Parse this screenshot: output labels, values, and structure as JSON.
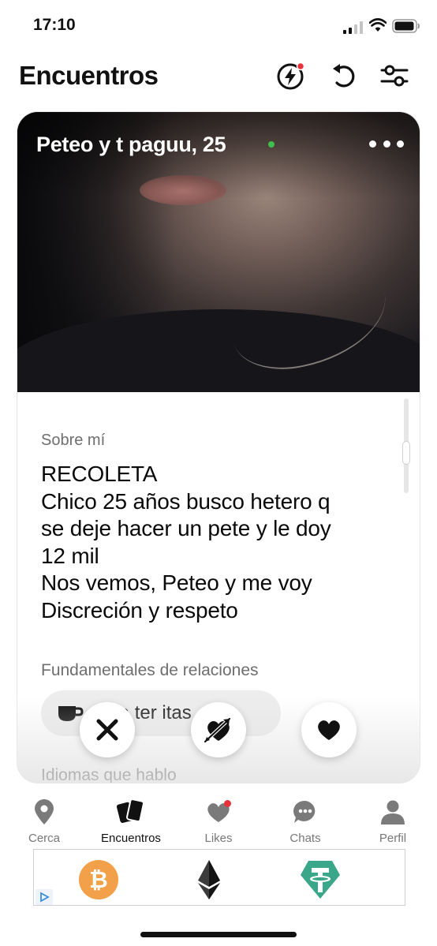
{
  "status_bar": {
    "time": "17:10"
  },
  "header": {
    "title": "Encuentros",
    "icons": [
      "boost-icon",
      "undo-icon",
      "filters-icon"
    ]
  },
  "profile": {
    "name_age": "Peteo y t paguu, 25",
    "online": true,
    "about_label": "Sobre mí",
    "bio_lines": [
      "RECOLETA",
      "Chico 25 años busco hetero q",
      "se deje hacer un pete y le doy",
      "12 mil",
      "Nos vemos, Peteo y me voy",
      "Discreción y respeto"
    ],
    "fundamentals_label": "Fundamentales de relaciones",
    "chip_visible_text": "para ter       itas",
    "languages_label": "Idiomas que hablo"
  },
  "actions": [
    "nope-x-icon",
    "super-like-heart-arrow-icon",
    "like-heart-icon"
  ],
  "bottom_nav": {
    "items": [
      {
        "label": "Cerca",
        "icon": "location-pin-icon",
        "active": false
      },
      {
        "label": "Encuentros",
        "icon": "cards-icon",
        "active": true
      },
      {
        "label": "Likes",
        "icon": "likes-icon",
        "active": false
      },
      {
        "label": "Chats",
        "icon": "chat-bubble-icon",
        "active": false
      },
      {
        "label": "Perfil",
        "icon": "profile-person-icon",
        "active": false
      }
    ]
  },
  "ad": {
    "coins": [
      "bitcoin-icon",
      "ethereum-icon",
      "tether-icon"
    ],
    "colors": {
      "bitcoin": "#f2a04a",
      "ethereum": "#3c3c3d",
      "tether": "#3aa68a"
    }
  },
  "colors": {
    "badge": "#e8323b",
    "online": "#3fbf4f",
    "text_primary": "#111111",
    "text_secondary": "#6e6e6e"
  }
}
